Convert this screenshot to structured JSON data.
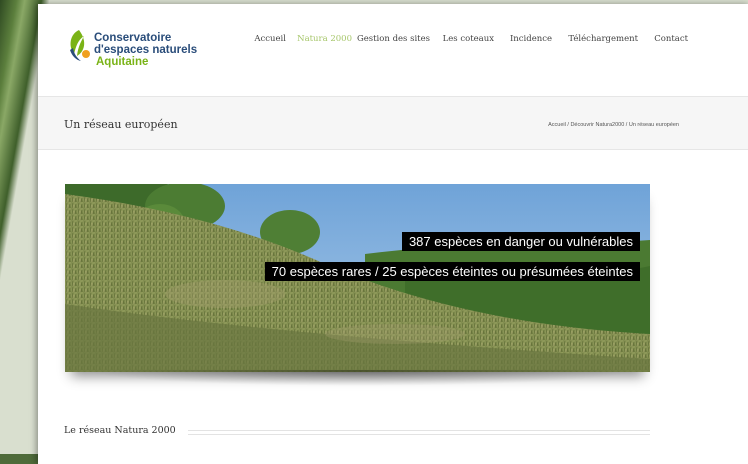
{
  "logo": {
    "line1": "Conservatoire",
    "line2": "d'espaces naturels",
    "line3": "Aquitaine"
  },
  "nav": {
    "items": [
      {
        "label": "Accueil",
        "active": false
      },
      {
        "label": "Natura 2000",
        "active": true
      },
      {
        "label": "Gestion des sites",
        "active": false
      },
      {
        "label": "Les coteaux",
        "active": false
      },
      {
        "label": "Incidence",
        "active": false
      },
      {
        "label": "Téléchargement",
        "active": false
      },
      {
        "label": "Contact",
        "active": false
      }
    ]
  },
  "titlebar": {
    "title": "Un réseau européen",
    "breadcrumb": "Accueil / Découvrir Natura2000 / Un réseau européen"
  },
  "hero": {
    "caption1": "387 espèces en danger ou vulnérables",
    "caption2": "70 espèces rares / 25 espèces éteintes ou présumées éteintes"
  },
  "section": {
    "title": "Le réseau Natura 2000"
  },
  "colors": {
    "accent": "#a6c66a",
    "logo_blue": "#2a4d7a",
    "logo_green": "#7ab317"
  }
}
